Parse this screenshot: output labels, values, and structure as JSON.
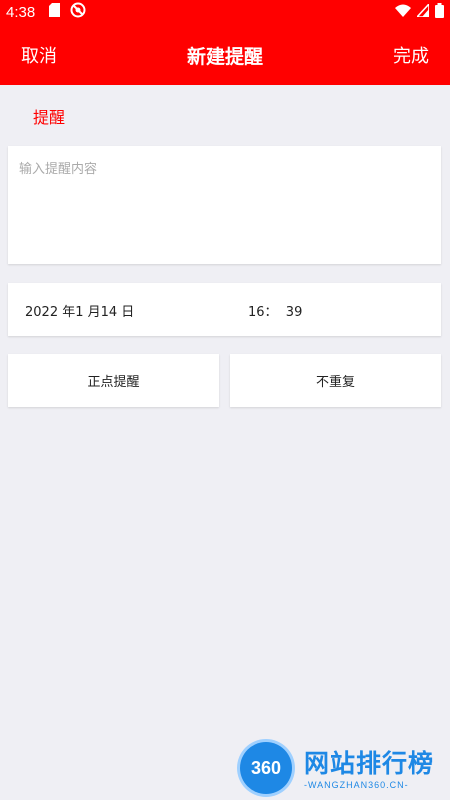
{
  "status_bar": {
    "time": "4:38",
    "icons": [
      "sd-card-icon",
      "blocked-circle-icon",
      "wifi-icon",
      "signal-icon",
      "battery-icon"
    ]
  },
  "header": {
    "cancel_label": "取消",
    "title": "新建提醒",
    "done_label": "完成",
    "color": "#ff0000"
  },
  "section_label": "提醒",
  "reminder_input": {
    "value": "",
    "placeholder": "输入提醒内容"
  },
  "datetime": {
    "date": "2022 年1 月14 日",
    "time": "16：  39"
  },
  "options": {
    "remind_type": "正点提醒",
    "repeat": "不重复"
  },
  "watermark": {
    "logo_text": "360",
    "brand": "网站排行榜",
    "sub": "-WANGZHAN360.CN-"
  }
}
